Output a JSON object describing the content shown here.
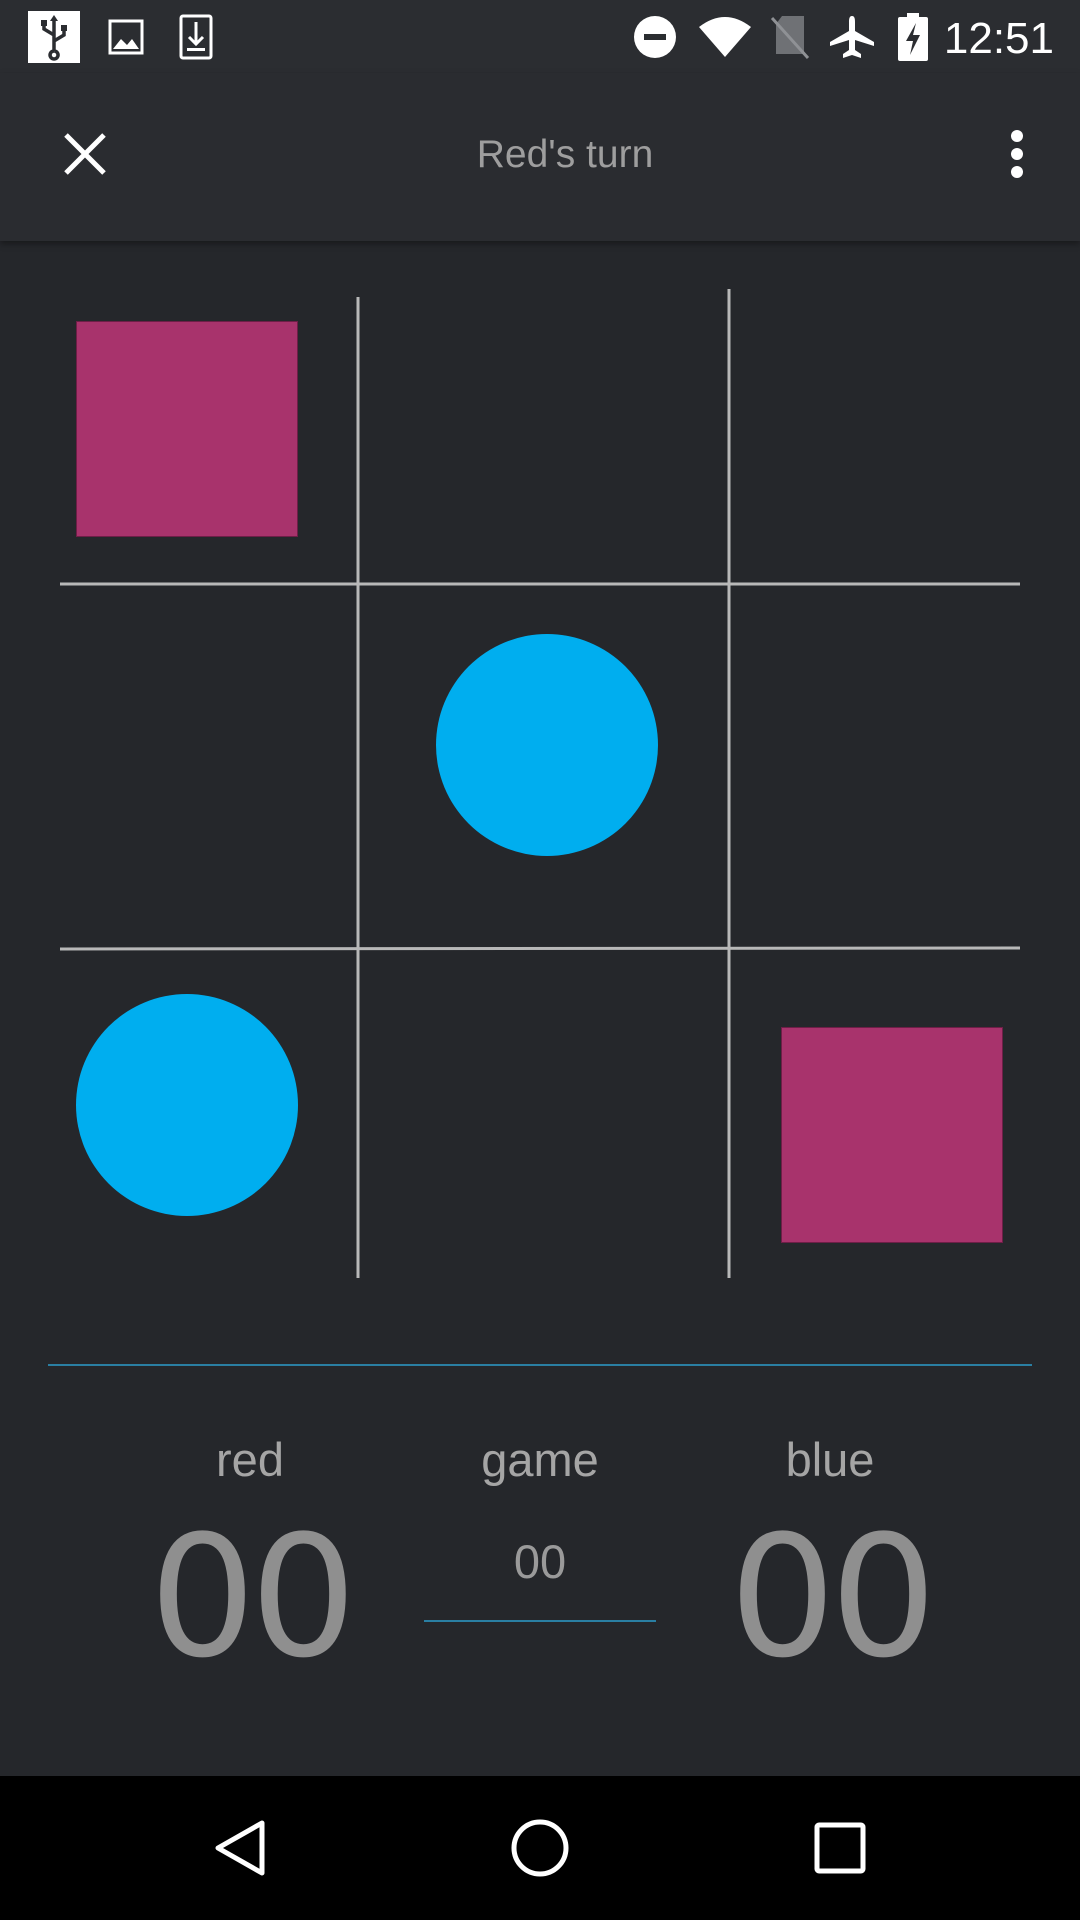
{
  "status_bar": {
    "time": "12:51",
    "left_icons": [
      "usb-icon",
      "image-icon",
      "download-icon"
    ],
    "right_icons": [
      "do-not-disturb-icon",
      "wifi-icon",
      "no-sim-icon",
      "airplane-icon",
      "battery-charging-icon"
    ]
  },
  "app_bar": {
    "title": "Red's turn",
    "close_icon": "close-icon",
    "menu_icon": "more-vert-icon"
  },
  "board": {
    "cells": [
      "red",
      "",
      "",
      "",
      "blue",
      "",
      "blue",
      "",
      "red"
    ]
  },
  "scores": {
    "red_label": "red",
    "red_value": "00",
    "game_label": "game",
    "game_value": "00",
    "blue_label": "blue",
    "blue_value": "00"
  },
  "colors": {
    "background": "#25272b",
    "red_piece": "#a8336c",
    "blue_piece": "#00aeef",
    "grid": "#b8b8b8",
    "accent_line": "#2a7fa3"
  },
  "nav_bar": {
    "icons": [
      "back-icon",
      "home-icon",
      "recents-icon"
    ]
  }
}
